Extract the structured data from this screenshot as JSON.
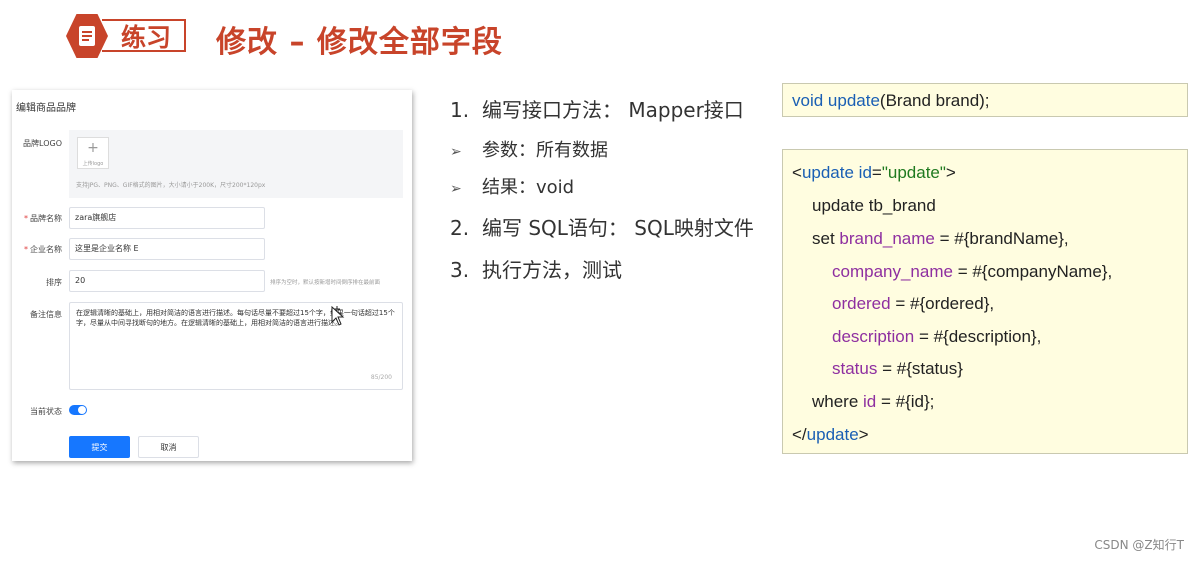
{
  "header": {
    "badge_label": "练习",
    "title": "修改 – 修改全部字段"
  },
  "form": {
    "title": "编辑商品品牌",
    "logo_label": "品牌LOGO",
    "upload_label": "上传logo",
    "logo_hint": "支持JPG、PNG、GIF格式的图片，大小请小于200K，尺寸200*120px",
    "brand_name_label": "品牌名称",
    "brand_name_value": "zara旗舰店",
    "company_name_label": "企业名称",
    "company_name_value": "这里是企业名称 E",
    "order_label": "排序",
    "order_value": "20",
    "order_hint": "排序为空时，默认按新增时间倒序排在最前面",
    "description_label": "备注信息",
    "description_value": "在逻辑清晰的基础上，用相对简洁的语言进行描述。每句话尽量不要超过15个字，如果一句话超过15个字，尽量从中间寻找断句的地方。在逻辑清晰的基础上，用相对简洁的语言进行描述。",
    "description_count": "85/200",
    "status_label": "当前状态",
    "status_on": true,
    "submit_label": "提交",
    "cancel_label": "取消"
  },
  "steps": {
    "step1_num": "1.",
    "step1_text": "编写接口方法： Mapper接口",
    "sub1_text": "参数：所有数据",
    "sub2_text": "结果：void",
    "step2_num": "2.",
    "step2_text": "编写 SQL语句： SQL映射文件",
    "step3_num": "3.",
    "step3_text": "执行方法，测试",
    "bullet_glyph": "➢"
  },
  "code_signature": {
    "kw_void": "void",
    "kw_update": "update",
    "rest": "(Brand brand);"
  },
  "code_xml": {
    "l1_open": "<",
    "l1_tag": "update",
    "l1_attr": " id",
    "l1_eq": "=",
    "l1_val": "\"update\"",
    "l1_close": ">",
    "l2": "update tb_brand",
    "l3_set": "set ",
    "l3_col": "brand_name",
    "l3_rest": " = #{brandName},",
    "l4_col": "company_name",
    "l4_rest": " = #{companyName},",
    "l5_col": "ordered",
    "l5_rest": " = #{ordered},",
    "l6_col": "description",
    "l6_rest": " = #{description},",
    "l7_col": "status",
    "l7_rest": " = #{status}",
    "l8_where": "where ",
    "l8_col": "id",
    "l8_rest": " = #{id};",
    "l9_open": "</",
    "l9_tag": "update",
    "l9_close": ">"
  },
  "watermark": "CSDN @Z知行T",
  "colors": {
    "accent_red": "#c8442a",
    "primary_blue": "#1677ff",
    "code_bg": "#fffde0"
  }
}
